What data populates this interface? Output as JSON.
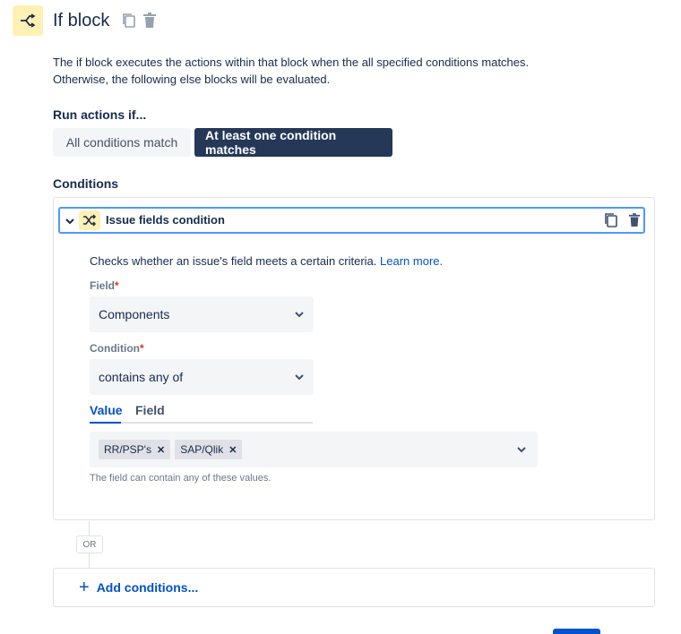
{
  "header": {
    "title": "If block",
    "icon": "branch-icon",
    "actions": [
      "copy-icon",
      "trash-icon"
    ]
  },
  "description": {
    "line1": "The if block executes the actions within that block when the all specified conditions matches.",
    "line2": "Otherwise, the following else blocks will be evaluated."
  },
  "run_actions": {
    "label": "Run actions if...",
    "options": [
      "All conditions match",
      "At least one condition matches"
    ],
    "selected": "At least one condition matches"
  },
  "conditions": {
    "title": "Conditions",
    "items": [
      {
        "name": "Issue fields condition",
        "icon": "shuffle-icon",
        "expanded": true,
        "description": "Checks whether an issue's field meets a certain criteria.",
        "learn_more": "Learn more.",
        "field_label": "Field",
        "field_value": "Components",
        "condition_label": "Condition",
        "condition_value": "contains any of",
        "tabs": [
          "Value",
          "Field"
        ],
        "active_tab": "Value",
        "values": [
          "RR/PSP's",
          "SAP/Qlik"
        ],
        "help": "The field can contain any of these values."
      }
    ]
  },
  "connector": {
    "label": "OR"
  },
  "add_conditions": {
    "label": "Add conditions..."
  },
  "colors": {
    "brand_blue": "#0052cc",
    "dark_navy": "#253858",
    "icon_yellow": "#fff0b3",
    "focus_blue": "#4c9aff"
  }
}
